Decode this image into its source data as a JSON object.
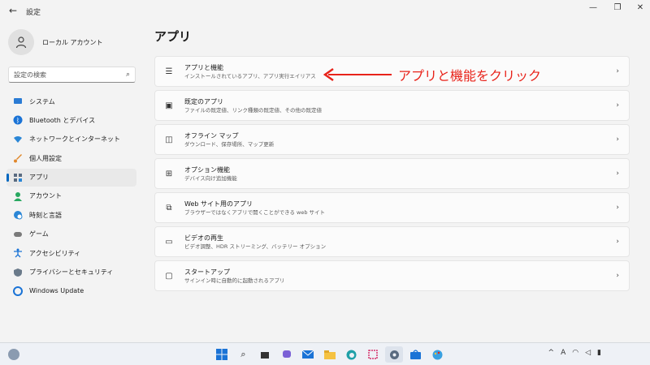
{
  "window": {
    "title": "設定",
    "back_icon": "back-arrow-icon",
    "controls": [
      "minimize-icon",
      "restore-icon",
      "close-icon"
    ]
  },
  "profile": {
    "name": "ローカル アカウント"
  },
  "search": {
    "placeholder": "設定の検索"
  },
  "sidebar": {
    "items": [
      {
        "label": "システム",
        "icon": "monitor-icon",
        "color": "#2a7bd4"
      },
      {
        "label": "Bluetooth とデバイス",
        "icon": "bluetooth-icon",
        "color": "#1a73d6"
      },
      {
        "label": "ネットワークとインターネット",
        "icon": "wifi-icon",
        "color": "#2a86d6"
      },
      {
        "label": "個人用設定",
        "icon": "brush-icon",
        "color": "#e0872a"
      },
      {
        "label": "アプリ",
        "icon": "apps-icon",
        "color": "#5a6b80"
      },
      {
        "label": "アカウント",
        "icon": "person-icon",
        "color": "#28a860"
      },
      {
        "label": "時刻と言語",
        "icon": "globe-clock-icon",
        "color": "#2a86d6"
      },
      {
        "label": "ゲーム",
        "icon": "gamepad-icon",
        "color": "#7a7a7a"
      },
      {
        "label": "アクセシビリティ",
        "icon": "accessibility-icon",
        "color": "#1a73d6"
      },
      {
        "label": "プライバシーとセキュリティ",
        "icon": "shield-icon",
        "color": "#6a7a8a"
      },
      {
        "label": "Windows Update",
        "icon": "update-icon",
        "color": "#1a73d6"
      }
    ],
    "active_index": 4
  },
  "main": {
    "title": "アプリ",
    "cards": [
      {
        "title": "アプリと機能",
        "subtitle": "インストールされているアプリ、アプリ実行エイリアス",
        "icon": "list-icon"
      },
      {
        "title": "既定のアプリ",
        "subtitle": "ファイルの既定値、リンク種類の既定値、その他の既定値",
        "icon": "default-app-icon"
      },
      {
        "title": "オフライン マップ",
        "subtitle": "ダウンロード、保存場所、マップ更新",
        "icon": "map-icon"
      },
      {
        "title": "オプション機能",
        "subtitle": "デバイス向け追加機能",
        "icon": "grid-plus-icon"
      },
      {
        "title": "Web サイト用のアプリ",
        "subtitle": "ブラウザーではなくアプリで開くことができる web サイト",
        "icon": "web-app-icon"
      },
      {
        "title": "ビデオの再生",
        "subtitle": "ビデオ調整、HDR ストリーミング、バッテリー オプション",
        "icon": "video-icon"
      },
      {
        "title": "スタートアップ",
        "subtitle": "サインイン時に自動的に起動されるアプリ",
        "icon": "startup-icon"
      }
    ]
  },
  "annotation": {
    "text": "アプリと機能をクリック",
    "color": "#e8231a"
  },
  "taskbar": {
    "apps": [
      "windows-logo-icon",
      "search-icon",
      "task-view-icon",
      "chat-icon",
      "mail-icon",
      "folder-icon",
      "edge-icon",
      "snip-icon",
      "settings-icon",
      "store-icon",
      "paint-icon"
    ],
    "active_index": 8,
    "tray": [
      "chevron-up-icon",
      "ime-icon",
      "wifi-icon",
      "volume-icon",
      "battery-icon"
    ],
    "ime_label": "A"
  }
}
